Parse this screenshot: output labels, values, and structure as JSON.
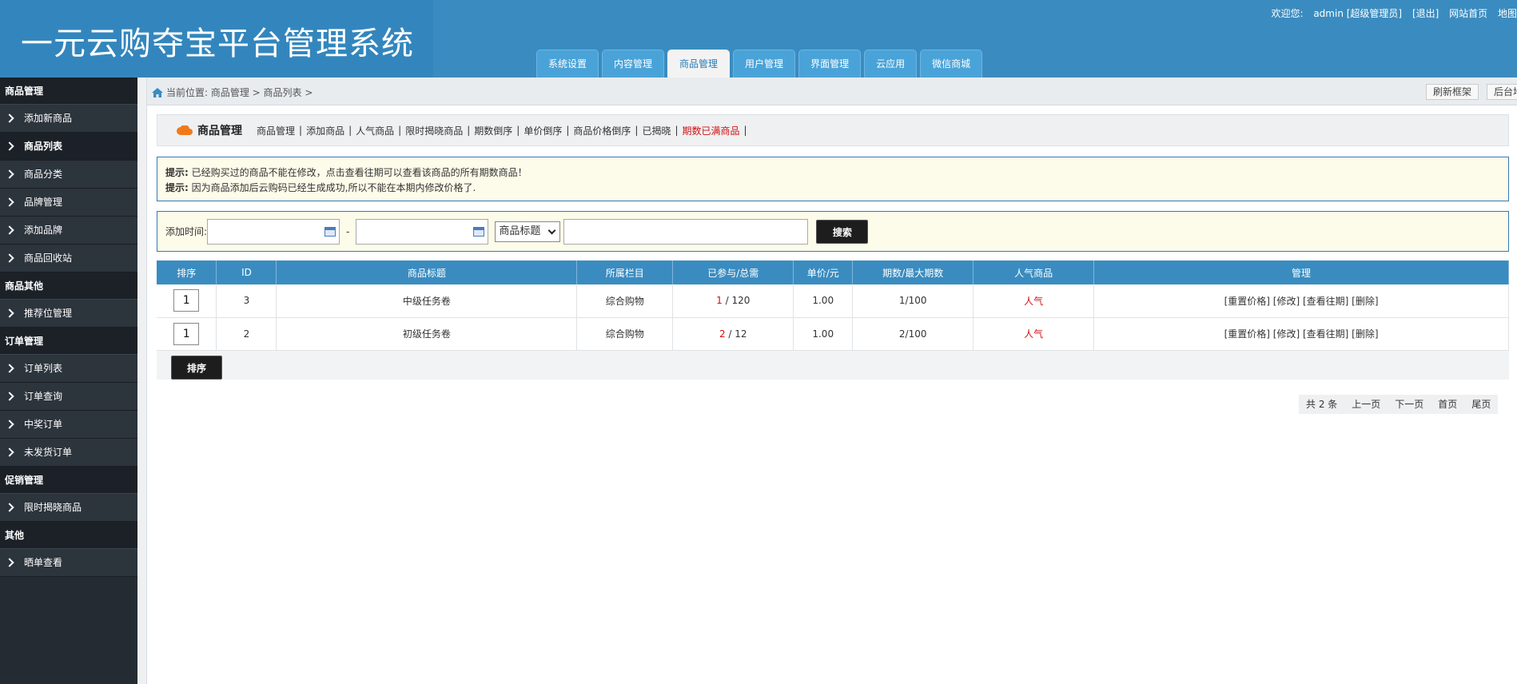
{
  "header": {
    "title": "一元云购夺宝平台管理系统",
    "welcome": "欢迎您:",
    "user": "admin [超级管理员]",
    "logout": "[退出]",
    "home": "网站首页",
    "map": "地图"
  },
  "nav": {
    "tabs": [
      "系统设置",
      "内容管理",
      "商品管理",
      "用户管理",
      "界面管理",
      "云应用",
      "微信商城"
    ],
    "active": "商品管理"
  },
  "sidebar": {
    "s1": "商品管理",
    "i1": "添加新商品",
    "i2": "商品列表",
    "i3": "商品分类",
    "i4": "品牌管理",
    "i5": "添加品牌",
    "i6": "商品回收站",
    "s2": "商品其他",
    "i7": "推荐位管理",
    "s3": "订单管理",
    "i8": "订单列表",
    "i9": "订单查询",
    "i10": "中奖订单",
    "i11": "未发货订单",
    "s4": "促销管理",
    "i12": "限时揭晓商品",
    "s5": "其他",
    "i13": "晒单查看"
  },
  "breadcrumb": {
    "text": "当前位置: 商品管理 > 商品列表 >",
    "refresh": "刷新框架",
    "map": "后台地图"
  },
  "subnav": {
    "title": "商品管理",
    "l1": "商品管理",
    "l2": "添加商品",
    "l3": "人气商品",
    "l4": "限时揭晓商品",
    "l5": "期数倒序",
    "l6": "单价倒序",
    "l7": "商品价格倒序",
    "l8": "已揭晓",
    "l9": "期数已满商品"
  },
  "tips": {
    "label": "提示:",
    "line1": "已经购买过的商品不能在修改，点击查看往期可以查看该商品的所有期数商品！",
    "line2": "因为商品添加后云购码已经生成成功,所以不能在本期内修改价格了."
  },
  "search": {
    "label": "添加时间:",
    "dash": "-",
    "select": "商品标题",
    "button": "搜索"
  },
  "table": {
    "headers": {
      "h1": "排序",
      "h2": "ID",
      "h3": "商品标题",
      "h4": "所属栏目",
      "h5": "已参与/总需",
      "h6": "单价/元",
      "h7": "期数/最大期数",
      "h8": "人气商品",
      "h9": "管理"
    },
    "rows": [
      {
        "order": "1",
        "id": "3",
        "title": "中级任务卷",
        "category": "综合购物",
        "joined": "1",
        "total": "/ 120",
        "price": "1.00",
        "periods": "1/100",
        "hot": "人气",
        "a1": "[重置价格]",
        "a2": "[修改]",
        "a3": "[查看往期]",
        "a4": "[删除]"
      },
      {
        "order": "1",
        "id": "2",
        "title": "初级任务卷",
        "category": "综合购物",
        "joined": "2",
        "total": "/ 12",
        "price": "1.00",
        "periods": "2/100",
        "hot": "人气",
        "a1": "[重置价格]",
        "a2": "[修改]",
        "a3": "[查看往期]",
        "a4": "[删除]"
      }
    ]
  },
  "sort_button": "排序",
  "pager": {
    "total": "共 2 条",
    "prev": "上一页",
    "next": "下一页",
    "first": "首页",
    "last": "尾页"
  },
  "colors": {
    "header": "#3a8cc0",
    "sidebar": "#242b33",
    "accent_red": "#d01010"
  }
}
